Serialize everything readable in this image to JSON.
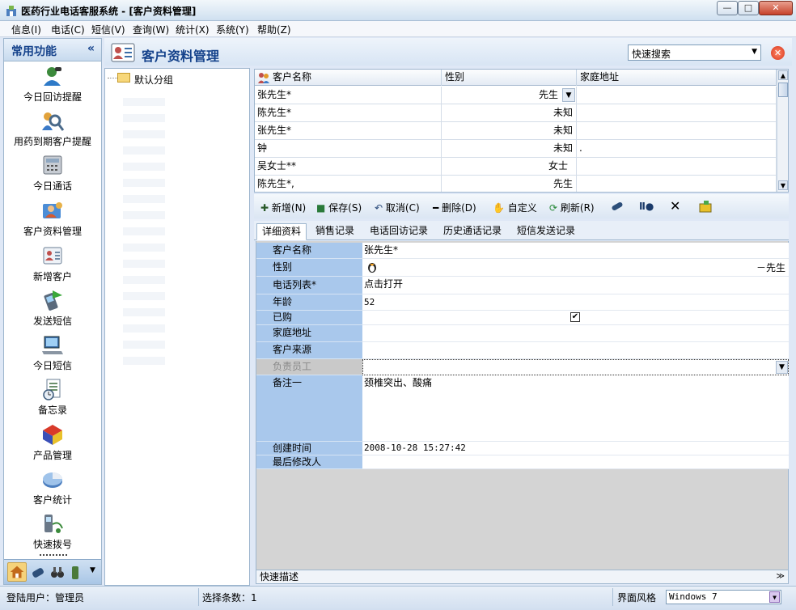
{
  "window": {
    "title": "医药行业电话客服系统 - [客户资料管理]",
    "minimize": "—",
    "maximize": "□",
    "close": "✕"
  },
  "menu": [
    {
      "label": "信息(I)"
    },
    {
      "label": "电话(C)"
    },
    {
      "label": "短信(V)"
    },
    {
      "label": "查询(W)"
    },
    {
      "label": "统计(X)"
    },
    {
      "label": "系统(Y)"
    },
    {
      "label": "帮助(Z)"
    }
  ],
  "sidebar": {
    "title": "常用功能",
    "collapse": "«",
    "items": [
      {
        "label": "今日回访提醒",
        "icon": "phone-person-icon"
      },
      {
        "label": "用药到期客户提醒",
        "icon": "magnifier-people-icon"
      },
      {
        "label": "今日通话",
        "icon": "telephone-icon"
      },
      {
        "label": "客户资料管理",
        "icon": "customer-card-icon"
      },
      {
        "label": "新增客户",
        "icon": "add-customer-icon"
      },
      {
        "label": "发送短信",
        "icon": "mobile-send-icon"
      },
      {
        "label": "今日短信",
        "icon": "laptop-sms-icon"
      },
      {
        "label": "备忘录",
        "icon": "memo-clock-icon"
      },
      {
        "label": "产品管理",
        "icon": "product-cubes-icon"
      },
      {
        "label": "客户统计",
        "icon": "pie-chart-icon"
      },
      {
        "label": "快速拨号",
        "icon": "quick-dial-icon"
      }
    ]
  },
  "page": {
    "title": "客户资料管理",
    "quick_search": "快速搜索"
  },
  "tree": {
    "root": "默认分组"
  },
  "grid": {
    "headers": [
      "客户名称",
      "性别",
      "家庭地址"
    ],
    "rows": [
      {
        "name": "张先生*",
        "gender": "先生",
        "address": ""
      },
      {
        "name": "陈先生*",
        "gender": "未知",
        "address": ""
      },
      {
        "name": "张先生*",
        "gender": "未知",
        "address": ""
      },
      {
        "name": "钟",
        "gender": "未知",
        "address": "."
      },
      {
        "name": "吴女士**",
        "gender": "女士",
        "address": ""
      },
      {
        "name": "陈先生*,",
        "gender": "先生",
        "address": ""
      }
    ]
  },
  "toolbar": {
    "add": "新增(N)",
    "save": "保存(S)",
    "cancel": "取消(C)",
    "delete": "删除(D)",
    "custom": "自定义",
    "refresh": "刷新(R)"
  },
  "tabs": [
    "详细资料",
    "销售记录",
    "电话回访记录",
    "历史通话记录",
    "短信发送记录"
  ],
  "detail": {
    "customer_name_label": "客户名称",
    "customer_name": "张先生*",
    "gender_label": "性别",
    "gender": "－先生",
    "phone_list_label": "电话列表*",
    "phone_list": "点击打开",
    "age_label": "年龄",
    "age": "52",
    "purchased_label": "已购",
    "address_label": "家庭地址",
    "address": "",
    "source_label": "客户来源",
    "source": "",
    "staff_label": "负责员工",
    "staff": "",
    "note_label": "备注一",
    "note": "颈椎突出、酸痛",
    "created_label": "创建时间",
    "created": "2008-10-28 15:27:42",
    "modifier_label": "最后修改人",
    "modifier": ""
  },
  "quick_desc": "快速描述",
  "status": {
    "user": "登陆用户：管理员",
    "selected": "选择条数：1",
    "style_label": "界面风格",
    "style_value": "Windows 7"
  },
  "colors": {
    "accent": "#15428b",
    "label_bg": "#a9c8ec",
    "close_red": "#d8331a"
  }
}
